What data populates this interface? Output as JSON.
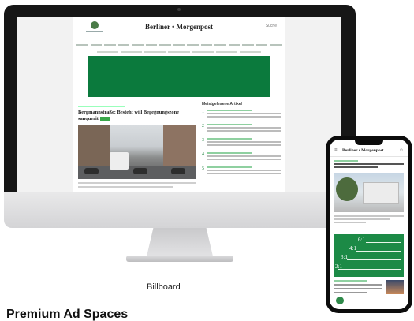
{
  "desktop": {
    "site_brand": "Berliner • Morgenpost",
    "search_label": "Suche",
    "headline": "Bergmannstraße: Besteht will Begegnungszone sanquerit",
    "sidebar_heading": "Meistgelesene Artikel",
    "sidebar_numbers": [
      "1",
      "2",
      "3",
      "4",
      "5"
    ],
    "ad_color": "#0b7a3d"
  },
  "caption": "Billboard",
  "bottom_title": "Premium Ad Spaces",
  "mobile": {
    "menu_icon": "≡",
    "site_brand": "Berliner • Morgenpost",
    "user_icon": "☺",
    "ad_labels": [
      "6:1",
      "4:1",
      "3:1",
      "2:1"
    ],
    "ad_color": "#1c8a46"
  }
}
